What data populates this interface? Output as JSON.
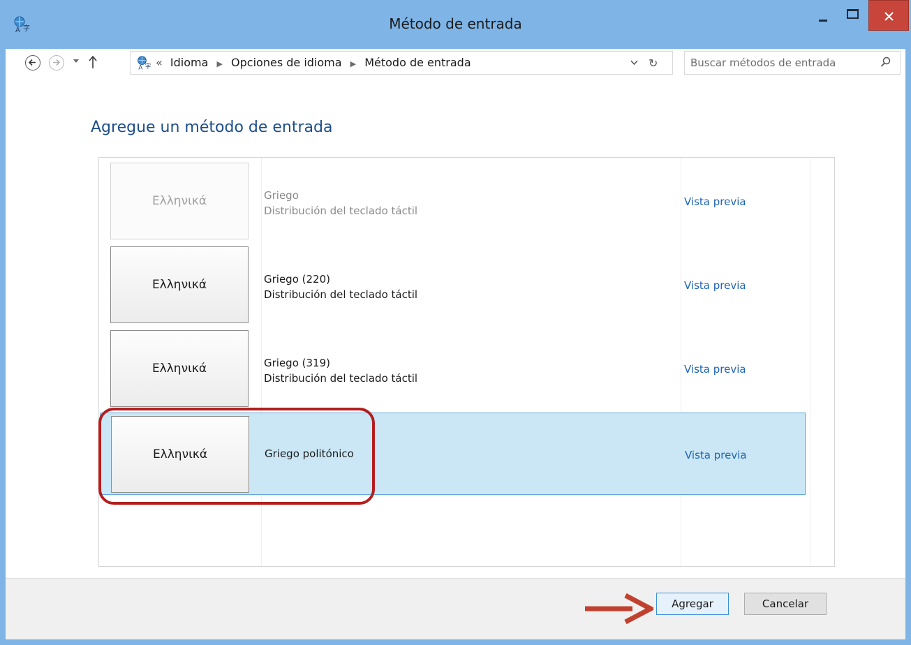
{
  "window": {
    "title": "Método de entrada"
  },
  "addressbar": {
    "crumbs": [
      "Idioma",
      "Opciones de idioma",
      "Método de entrada"
    ],
    "overflow": "«",
    "search_placeholder": "Buscar métodos de entrada"
  },
  "main": {
    "heading": "Agregue un método de entrada",
    "preview_label": "Vista previa",
    "items": [
      {
        "keyboard_label": "Ελληνικά",
        "name": "Griego",
        "type": "Distribución del teclado táctil",
        "dimmed": true,
        "selected": false
      },
      {
        "keyboard_label": "Ελληνικά",
        "name": "Griego (220)",
        "type": "Distribución del teclado táctil",
        "dimmed": false,
        "selected": false
      },
      {
        "keyboard_label": "Ελληνικά",
        "name": "Griego (319)",
        "type": "Distribución del teclado táctil",
        "dimmed": false,
        "selected": false
      },
      {
        "keyboard_label": "Ελληνικά",
        "name": "Griego politónico",
        "type": "",
        "dimmed": false,
        "selected": true
      }
    ]
  },
  "footer": {
    "add_label": "Agregar",
    "cancel_label": "Cancelar"
  },
  "colors": {
    "titlebar": "#7EB4E6",
    "close_button": "#C7453A",
    "heading": "#1E4E8C",
    "link": "#1E64B4",
    "selection": "#CBE7F5",
    "annotation": "#B41E1E"
  },
  "icons": [
    "language-icon",
    "back-icon",
    "forward-icon",
    "chevron-down-icon",
    "up-arrow-icon",
    "refresh-icon",
    "search-icon",
    "close-icon",
    "minimize-icon",
    "maximize-icon",
    "arrow-annotation-icon"
  ]
}
